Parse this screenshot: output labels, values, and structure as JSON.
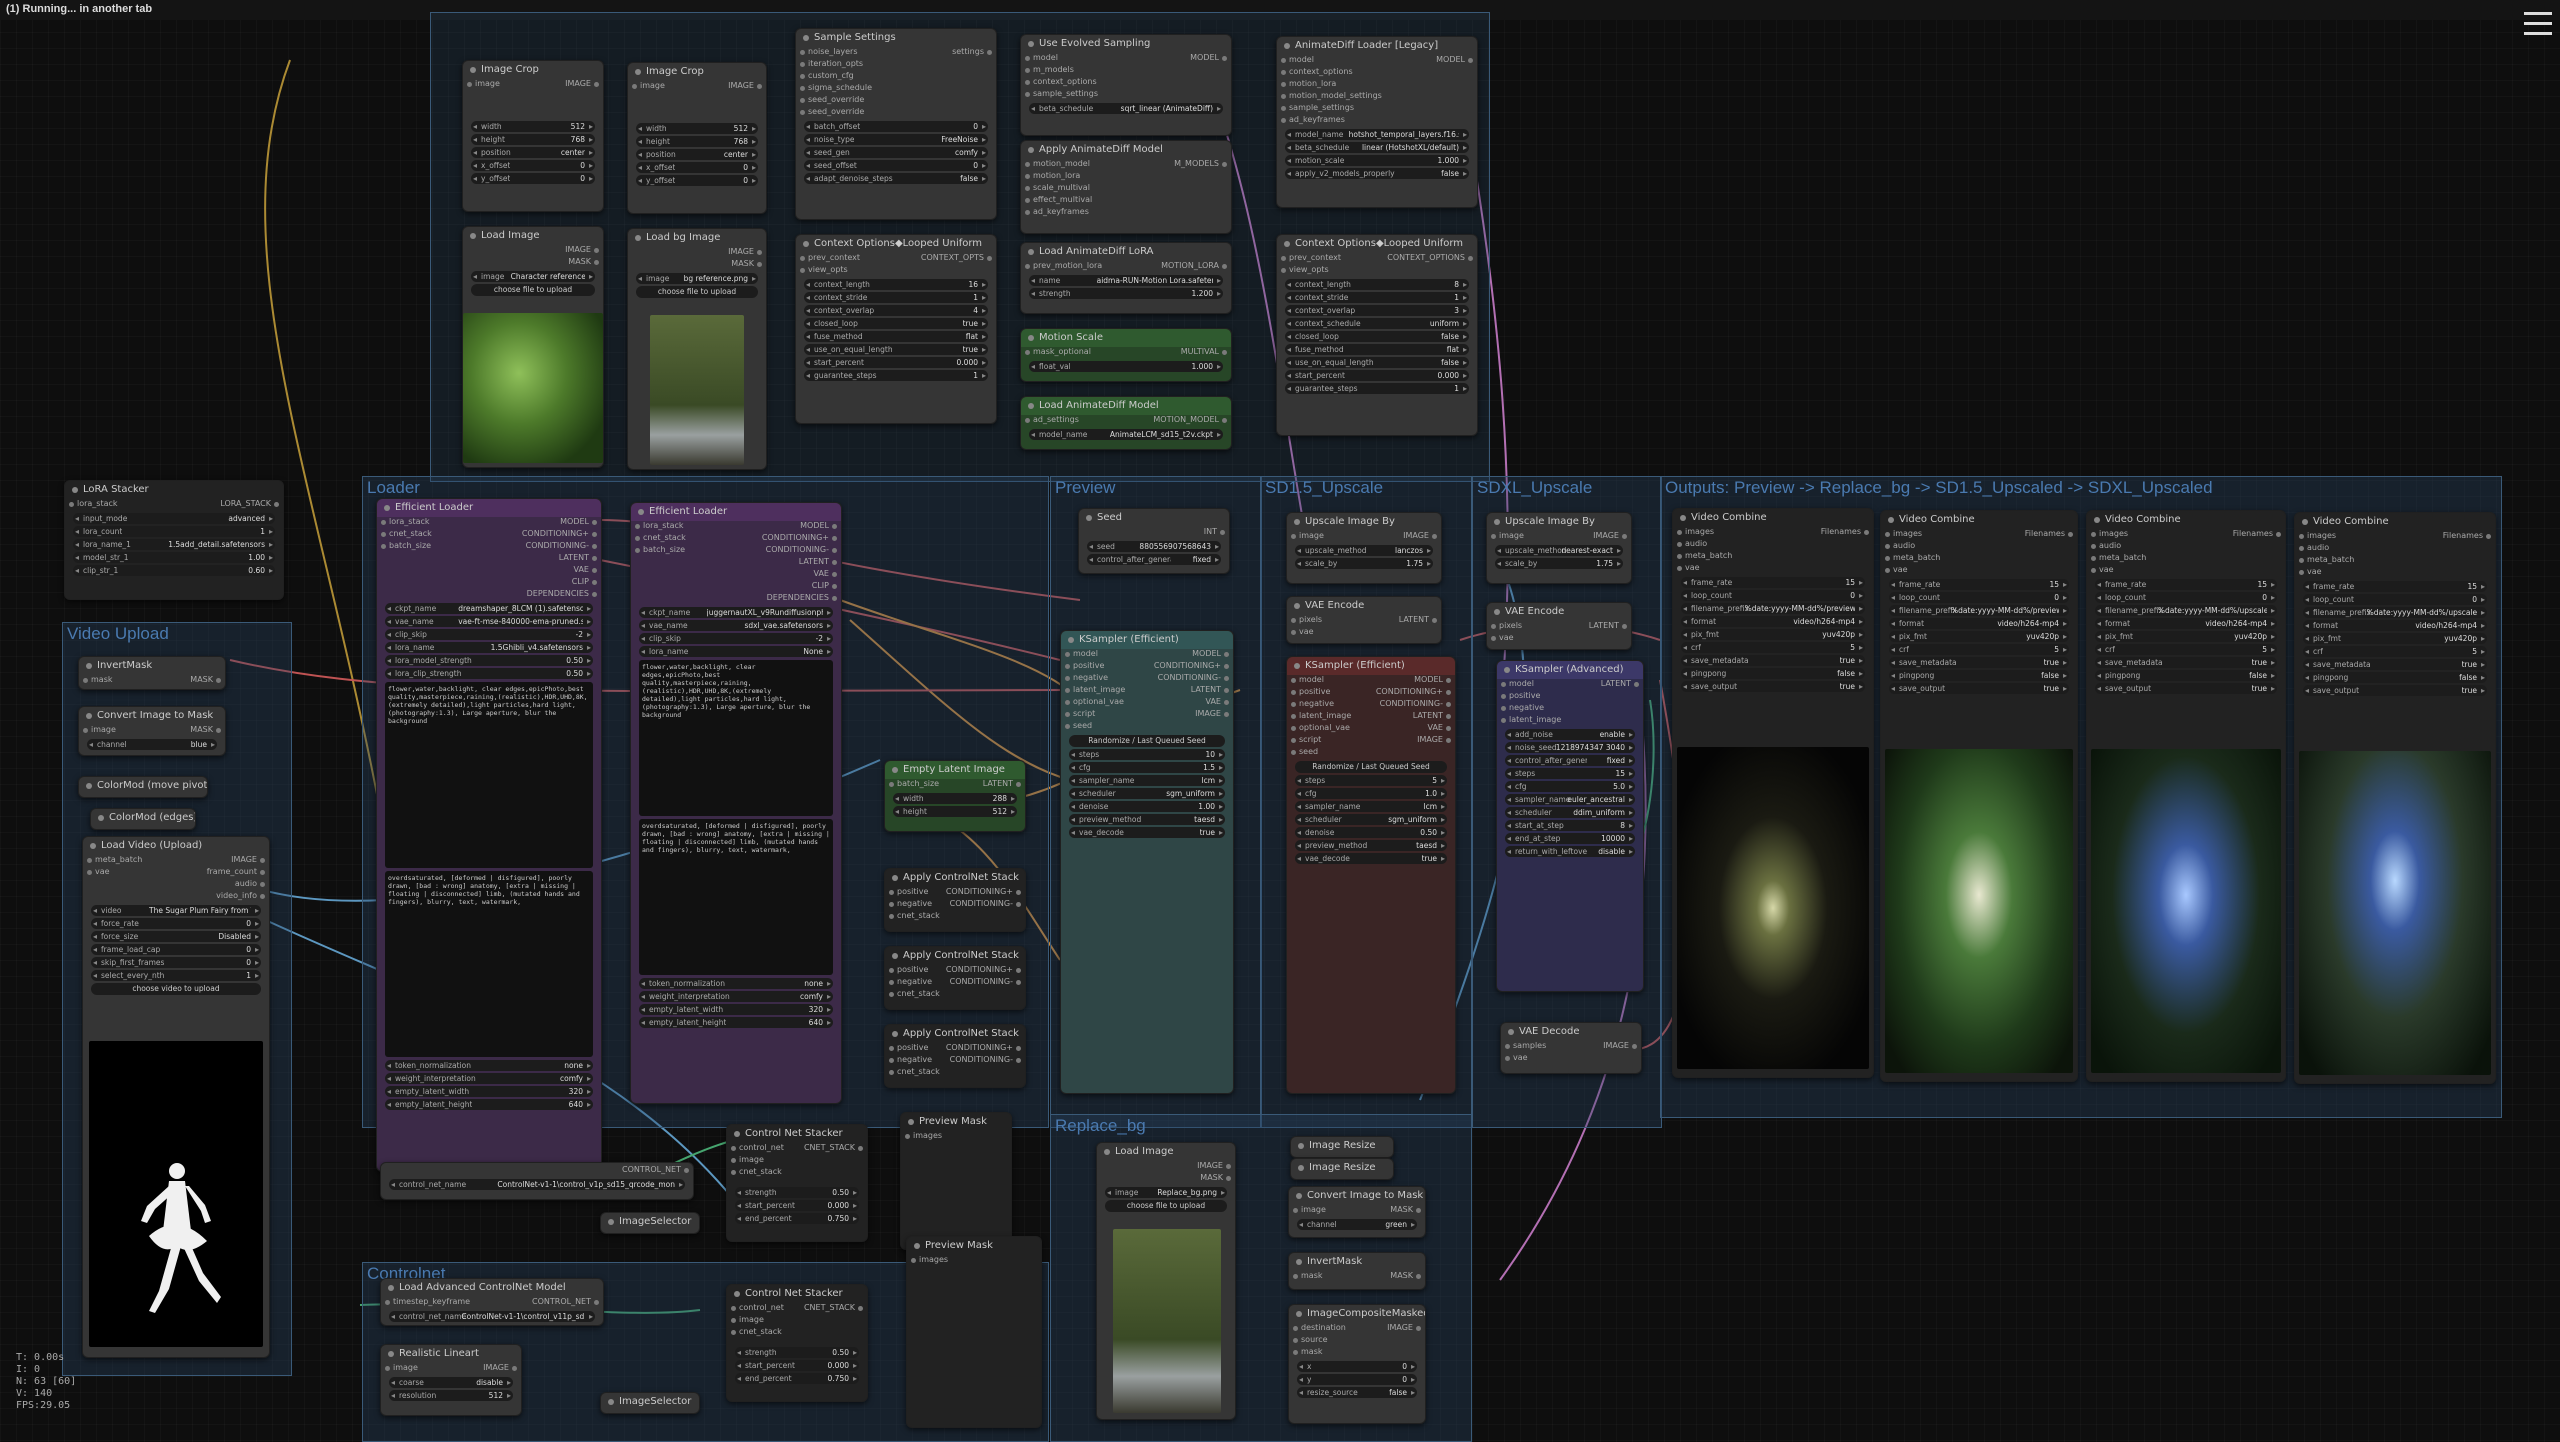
{
  "window": {
    "title": "(1) Running... in another tab"
  },
  "groups": {
    "loader": "Loader",
    "preview": "Preview",
    "sd15_upscale": "SD1.5_Upscale",
    "sdxl_upscale": "SDXL_Upscale",
    "outputs": "Outputs: Preview -> Replace_bg -> SD1.5_Upscaled -> SDXL_Upscaled",
    "video_upload": "Video Upload",
    "replace_bg": "Replace_bg",
    "controlnet": "Controlnet"
  },
  "nodes": {
    "image_crop_1": {
      "title": "Image Crop",
      "width": "512",
      "height": "768",
      "position": "center",
      "x_offset": "0",
      "y_offset": "0"
    },
    "image_crop_2": {
      "title": "Image Crop",
      "width": "512",
      "height": "768",
      "position": "center",
      "x_offset": "0",
      "y_offset": "0"
    },
    "load_image_1": {
      "title": "Load Image",
      "image": "Character reference.jpg",
      "upload": "choose file to upload"
    },
    "load_bg_image": {
      "title": "Load bg Image",
      "image": "bg reference.png",
      "upload": "choose file to upload"
    },
    "sample_settings": {
      "title": "Sample Settings",
      "rows": [
        "noise_layers",
        "iteration_opts",
        "custom_cfg",
        "sigma_schedule",
        "seed_override",
        "seed_override"
      ],
      "batch_offset": "0",
      "noise_type": "FreeNoise",
      "seed_gen": "comfy",
      "seed_offset": "0",
      "adapt": "adapt_denoise_steps",
      "adapt_v": "false"
    },
    "use_evolved_sampling": {
      "title": "Use Evolved Sampling",
      "beta_schedule": "sqrt_linear (AnimateDiff)"
    },
    "apply_animatediff_model": {
      "title": "Apply AnimateDiff Model"
    },
    "context_options_1": {
      "title": "Context Options◆Looped Uniform",
      "context_length": "16",
      "context_stride": "1",
      "context_overlap": "4",
      "closed_loop": "true",
      "fuse_method": "flat",
      "use_on_equal_length": "true",
      "start_percent": "0.000",
      "guarantee_steps": "1"
    },
    "load_animatediff_lora": {
      "title": "Load AnimateDiff LoRA",
      "name": "aidma-RUN-Motion Lora.safetensors",
      "strength": "1.200"
    },
    "motion_scale": {
      "title": "Motion Scale",
      "float_val": "1.000"
    },
    "load_animatediff_model": {
      "title": "Load AnimateDiff Model",
      "model_name": "AnimateLCM_sd15_t2v.ckpt"
    },
    "animatediff_loader_legacy": {
      "title": "AnimateDiff Loader [Legacy]",
      "model_name": "hotshot_temporal_layers.f16.safetensors",
      "beta_schedule": "linear (HotshotXL/default)",
      "motion_scale": "1.000",
      "apply_v2": "apply_v2_models_properly",
      "apply_v2_v": "false"
    },
    "context_options_2": {
      "title": "Context Options◆Looped Uniform",
      "context_length": "8",
      "context_stride": "1",
      "context_overlap": "3",
      "context_schedule": "uniform",
      "closed_loop": "false",
      "fuse_method": "flat",
      "use_on_equal_length": "false",
      "start_percent": "0.000",
      "guarantee_steps": "1"
    },
    "lora_stacker": {
      "title": "LoRA Stacker",
      "input_mode": "advanced",
      "lora_count": "1",
      "lora_name_1": "1.5add_detail.safetensors",
      "model_str_1": "1.00",
      "clip_str_1": "0.60"
    },
    "efficient_loader_1": {
      "title": "Efficient Loader",
      "ckpt_name": "dreamshaper_8LCM (1).safetensors",
      "vae_name": "vae-ft-mse-840000-ema-pruned.safetensors",
      "clip_skip": "-2",
      "lora_name": "1.5Ghibli_v4.safetensors",
      "lora_model_strength": "0.50",
      "lora_clip_strength": "0.50",
      "positive": "flower,water,backlight, clear edges,epicPhoto,best quality,masterpiece,raining,(realistic),HDR,UHD,8K,(extremely detailed),light particles,hard light,(photography:1.3), Large aperture, blur the background",
      "negative": "overdsaturated, [deformed | disfigured], poorly drawn, [bad : wrong] anatomy, [extra | missing | floating | disconnected] limb, (mutated hands and fingers), blurry, text, watermark,",
      "token_normalization": "none",
      "weight_interpretation": "comfy",
      "empty_latent_width": "320",
      "empty_latent_height": "640"
    },
    "efficient_loader_2": {
      "title": "Efficient Loader",
      "ckpt_name": "juggernautXL_v9Rundiffusionphoto2.safetensors",
      "vae_name": "sdxl_vae.safetensors",
      "clip_skip": "-2",
      "lora_name": "None",
      "positive": "flower,water,backlight, clear edges,epicPhoto,best quality,masterpiece,raining,(realistic),HDR,UHD,8K,(extremely detailed),light particles,hard light,(photography:1.3), Large aperture, blur the background",
      "negative": "overdsaturated, [deformed | disfigured], poorly drawn, [bad : wrong] anatomy, [extra | missing | floating | disconnected] limb, (mutated hands and fingers), blurry, text, watermark,",
      "token_normalization": "none",
      "weight_interpretation": "comfy",
      "empty_latent_width": "320",
      "empty_latent_height": "640"
    },
    "seed": {
      "title": "Seed",
      "seed": "880556907568643",
      "control": "fixed"
    },
    "empty_latent_image": {
      "title": "Empty Latent Image",
      "width": "288",
      "height": "512"
    },
    "ksampler_1": {
      "title": "KSampler (Efficient)",
      "mode": "Randomize / Last Queued Seed",
      "steps": "10",
      "cfg": "1.5",
      "sampler_name": "lcm",
      "scheduler": "sgm_uniform",
      "denoise": "1.00",
      "preview_method": "taesd",
      "vae_decode": "true"
    },
    "upscale_image_by_1": {
      "title": "Upscale Image By",
      "method": "lanczos",
      "scale_by": "1.75"
    },
    "vae_encode_1": {
      "title": "VAE Encode"
    },
    "ksampler_2": {
      "title": "KSampler (Efficient)",
      "mode": "Randomize / Last Queued Seed",
      "steps": "5",
      "cfg": "1.0",
      "sampler_name": "lcm",
      "scheduler": "sgm_uniform",
      "denoise": "0.50",
      "preview_method": "taesd",
      "vae_decode": "true"
    },
    "upscale_image_by_2": {
      "title": "Upscale Image By",
      "method": "nearest-exact",
      "scale_by": "1.75"
    },
    "vae_encode_2": {
      "title": "VAE Encode"
    },
    "ksampler_adv": {
      "title": "KSampler (Advanced)",
      "add_noise": "enable",
      "noise_seed": "1218974347 3040",
      "control": "fixed",
      "steps": "15",
      "cfg": "5.0",
      "sampler_name": "euler_ancestral",
      "scheduler": "ddim_uniform",
      "start_at_step": "8",
      "end_at_step": "10000",
      "return": "disable"
    },
    "vae_decode": {
      "title": "VAE Decode"
    },
    "video_combine_1": {
      "title": "Video Combine",
      "frame_rate": "15",
      "loop_count": "0",
      "filename_prefix": "%date:yyyy-MM-dd%/previews/AD",
      "format": "video/h264-mp4",
      "pix_fmt": "yuv420p",
      "crf": "5",
      "save_metadata": "true",
      "pingpong": "false",
      "save_output": "true"
    },
    "video_combine_2": {
      "title": "Video Combine",
      "frame_rate": "15",
      "loop_count": "0",
      "filename_prefix": "%date:yyyy-MM-dd%/previews/AD",
      "format": "video/h264-mp4",
      "pix_fmt": "yuv420p",
      "crf": "5",
      "save_metadata": "true",
      "pingpong": "false",
      "save_output": "true"
    },
    "video_combine_3": {
      "title": "Video Combine",
      "frame_rate": "15",
      "loop_count": "0",
      "filename_prefix": "%date:yyyy-MM-dd%/upscaled/%da",
      "format": "video/h264-mp4",
      "pix_fmt": "yuv420p",
      "crf": "5",
      "save_metadata": "true",
      "pingpong": "false",
      "save_output": "true"
    },
    "video_combine_4": {
      "title": "Video Combine",
      "frame_rate": "15",
      "loop_count": "0",
      "filename_prefix": "%date:yyyy-MM-dd%/upscaled/%da",
      "format": "video/h264-mp4",
      "pix_fmt": "yuv420p",
      "crf": "5",
      "save_metadata": "true",
      "pingpong": "false",
      "save_output": "true"
    },
    "invert_mask": {
      "title": "InvertMask"
    },
    "convert_image_to_mask": {
      "title": "Convert Image to Mask",
      "channel": "blue"
    },
    "colormod_pivot": {
      "title": "ColorMod (move pivot"
    },
    "colormod_edges": {
      "title": "ColorMod (edges)"
    },
    "load_video": {
      "title": "Load Video (Upload)",
      "video": "The Sugar Plum Fairy from The Nutcracker (The Royal Ballet).mp4",
      "force_rate": "0",
      "force_size": "Disabled",
      "frame_load_cap": "0",
      "skip_first_frames": "0",
      "select_every_nth": "1",
      "upload": "choose video to upload"
    },
    "apply_controlnet_1": {
      "title": "Apply ControlNet Stack"
    },
    "apply_controlnet_2": {
      "title": "Apply ControlNet Stack"
    },
    "apply_controlnet_3": {
      "title": "Apply ControlNet Stack"
    },
    "control_net_stacker_1": {
      "title": "Control Net Stacker",
      "strength": "0.50",
      "start_percent": "0.000",
      "end_percent": "0.750"
    },
    "control_net_stacker_2": {
      "title": "Control Net Stacker",
      "strength": "0.50",
      "start_percent": "0.000",
      "end_percent": "0.750"
    },
    "controlnet_name_node": {
      "control_net_name": "ControlNet-v1-1\\control_v1p_sd15_qrcode_monster.ckpt"
    },
    "load_adv_controlnet": {
      "title": "Load Advanced ControlNet Model",
      "name": "ControlNet-v1-1\\control_v11p_sd15_lineart.pth"
    },
    "realistic_lineart": {
      "title": "Realistic Lineart",
      "coarse": "disable",
      "resolution": "512"
    },
    "image_selector_1": {
      "title": "ImageSelector"
    },
    "image_selector_2": {
      "title": "ImageSelector"
    },
    "preview_mask_1": {
      "title": "Preview Mask"
    },
    "preview_mask_2": {
      "title": "Preview Mask"
    },
    "load_image_replace": {
      "title": "Load Image",
      "image": "Replace_bg.png",
      "upload": "choose file to upload"
    },
    "image_resize_1": {
      "title": "Image Resize"
    },
    "image_resize_2": {
      "title": "Image Resize"
    },
    "convert_image_to_mask_2": {
      "title": "Convert Image to Mask",
      "channel": "green"
    },
    "invert_mask_2": {
      "title": "InvertMask"
    },
    "image_composite_masked": {
      "title": "ImageCompositeMasked",
      "x": "0",
      "y": "0",
      "resize_source": "false"
    }
  },
  "stats": {
    "t": "T: 0.00s",
    "i": "I: 0",
    "n": "N: 63 [60]",
    "v": "V: 140",
    "fps": "FPS:29.05"
  }
}
